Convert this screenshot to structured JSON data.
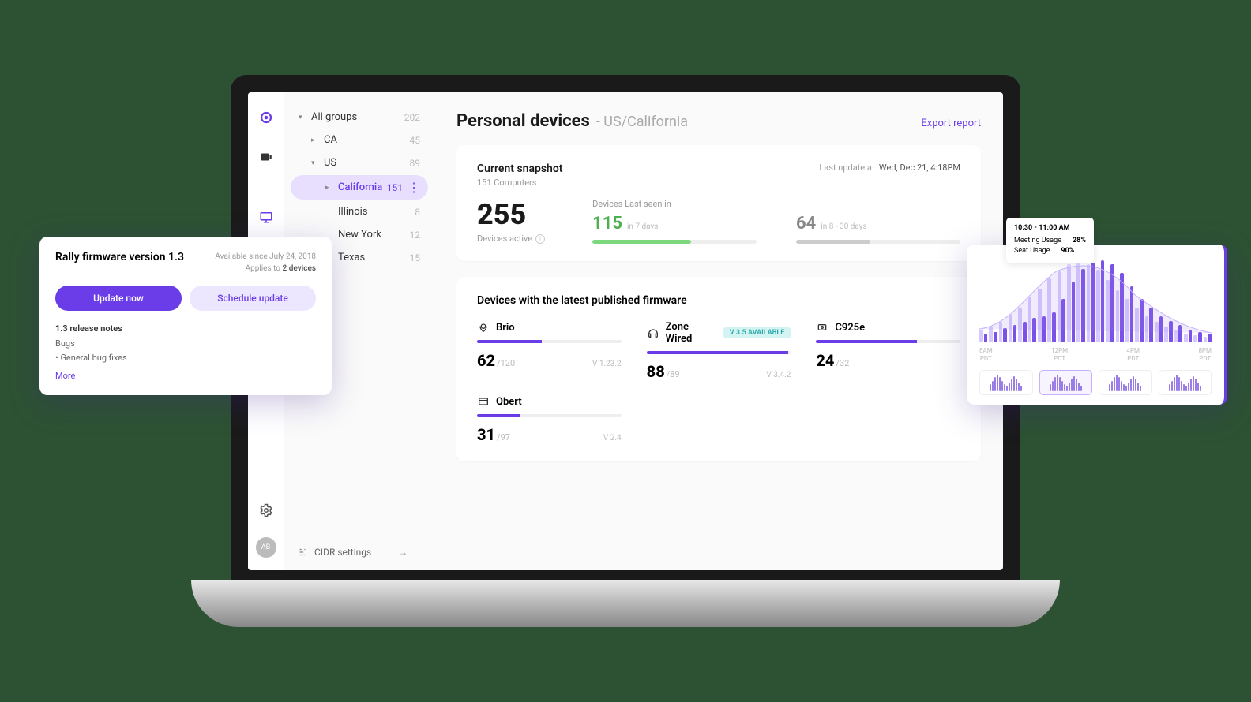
{
  "iconbar": {
    "avatar": "AB"
  },
  "tree": {
    "items": [
      {
        "label": "All groups",
        "count": "202",
        "chev": "▾",
        "lvl": 0
      },
      {
        "label": "CA",
        "count": "45",
        "chev": "▸",
        "lvl": 1
      },
      {
        "label": "US",
        "count": "89",
        "chev": "▾",
        "lvl": 1
      },
      {
        "label": "California",
        "count": "151",
        "chev": "▸",
        "lvl": 2,
        "sel": true
      },
      {
        "label": "Illinois",
        "count": "8",
        "lvl": 2
      },
      {
        "label": "New York",
        "count": "12",
        "lvl": 2
      },
      {
        "label": "Texas",
        "count": "15",
        "lvl": 2
      }
    ],
    "cidr": "CIDR settings"
  },
  "header": {
    "title": "Personal devices",
    "sub": "- US/California",
    "export": "Export report"
  },
  "snapshot": {
    "title": "Current snapshot",
    "sub": "151 Computers",
    "last_prefix": "Last update at",
    "last_date": "Wed, Dec 21, 4:18PM",
    "active_num": "255",
    "active_label": "Devices active",
    "seen_label": "Devices Last seen in",
    "seen": [
      {
        "n": "115",
        "t": "in 7 days"
      },
      {
        "n": "64",
        "t": "in 8 - 30 days"
      }
    ]
  },
  "firmware_section": {
    "title": "Devices with the latest published firmware",
    "items": [
      {
        "name": "Brio",
        "n": "62",
        "total": "/120",
        "ver": "V 1.23.2",
        "pct": 45
      },
      {
        "name": "Zone Wired",
        "n": "88",
        "total": "/89",
        "ver": "V 3.4.2",
        "pct": 98,
        "avail": "V 3.5 AVAILABLE"
      },
      {
        "name": "C925e",
        "n": "24",
        "total": "/32",
        "ver": "",
        "pct": 70
      },
      {
        "name": "Qbert",
        "n": "31",
        "total": "/97",
        "ver": "V 2.4",
        "pct": 30
      }
    ]
  },
  "firmware_popup": {
    "title": "Rally firmware version 1.3",
    "avail": "Available since July 24, 2018",
    "applies_prefix": "Applies to",
    "applies_count": "2 devices",
    "btn_primary": "Update now",
    "btn_secondary": "Schedule update",
    "notes_title": "1.3 release notes",
    "bugs": "Bugs",
    "bullet": "• General bug fixes",
    "more": "More"
  },
  "chart_popup": {
    "tooltip": {
      "time": "10:30 - 11:00 AM",
      "rows": [
        {
          "k": "Meeting Usage",
          "v": "28%"
        },
        {
          "k": "Seat Usage",
          "v": "90%"
        }
      ]
    },
    "xaxis": [
      {
        "t": "8AM",
        "z": "PDT"
      },
      {
        "t": "12PM",
        "z": "PDT"
      },
      {
        "t": "4PM",
        "z": "PDT"
      },
      {
        "t": "8PM",
        "z": "PDT"
      }
    ]
  },
  "chart_data": {
    "type": "bar",
    "title": "",
    "categories": [
      "8AM",
      "12PM",
      "4PM",
      "8PM"
    ],
    "series": [
      {
        "name": "Meeting Usage",
        "values": [
          10,
          12,
          16,
          20,
          24,
          28,
          30,
          35,
          50,
          70,
          85,
          92,
          95,
          90,
          80,
          65,
          50,
          40,
          30,
          25,
          20,
          15,
          12,
          10
        ]
      },
      {
        "name": "Seat Usage",
        "values": [
          15,
          18,
          24,
          32,
          40,
          52,
          62,
          74,
          82,
          90,
          92,
          90,
          84,
          72,
          60,
          50,
          40,
          30,
          24,
          18,
          14,
          10,
          8,
          6
        ]
      }
    ],
    "ylim": [
      0,
      100
    ]
  }
}
